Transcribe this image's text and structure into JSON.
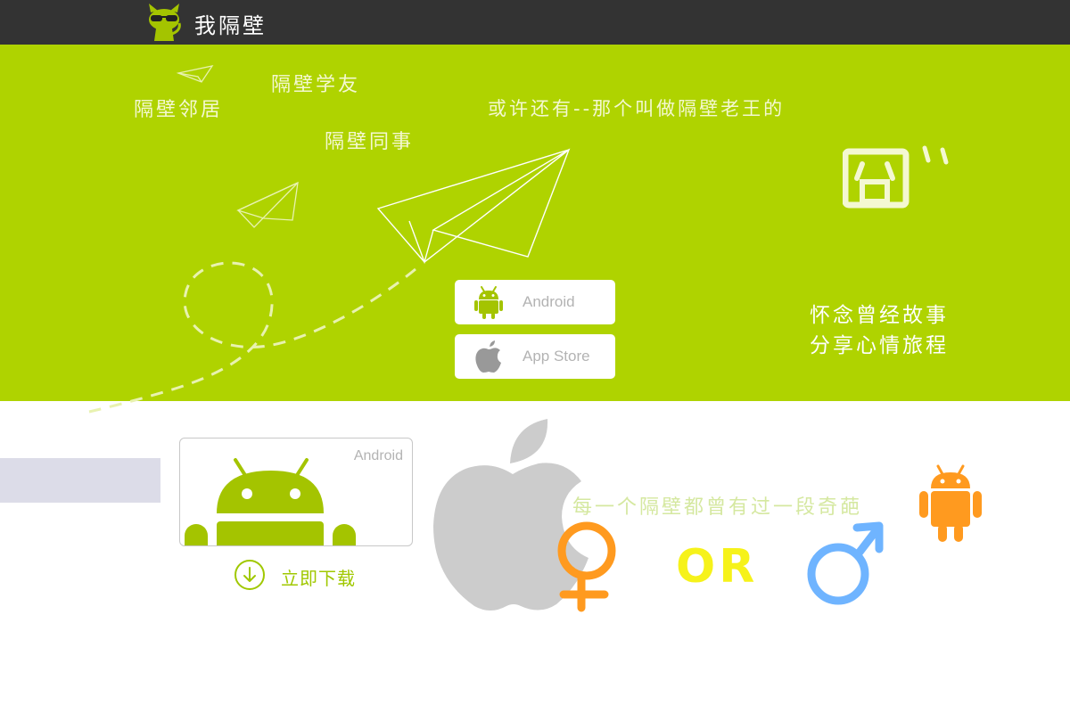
{
  "brand": {
    "name": "我隔壁"
  },
  "hero": {
    "floating_labels": {
      "neighbor": "隔壁邻居",
      "classmate": "隔壁学友",
      "colleague": "隔壁同事",
      "lao_wang": "或许还有--那个叫做隔壁老王的",
      "emoticon": "囧"
    },
    "buttons": {
      "android": "Android",
      "app_store": "App Store"
    },
    "slogan": {
      "line1": "怀念曾经故事",
      "line2": "分享心情旅程"
    }
  },
  "download": {
    "card_tag": "Android",
    "link_label": "立即下载"
  },
  "promo": {
    "tagline": "每一个隔壁都曾有过一段奇葩",
    "or_text": "OR"
  },
  "colors": {
    "top_bar": "#333333",
    "hero_green": "#afd300",
    "android_green": "#a4c400",
    "female_orange": "#ff9a1f",
    "male_blue": "#6fb4ff",
    "or_yellow": "#f6f21a",
    "apple_gray": "#cccccc"
  }
}
